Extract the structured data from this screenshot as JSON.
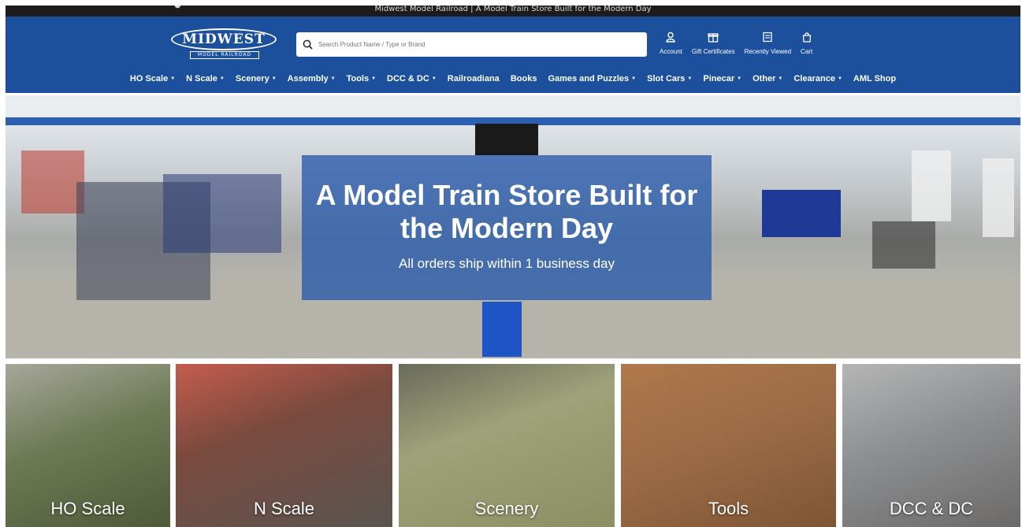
{
  "announcement": {
    "text": "Midwest Model Railroad | A Model Train Store Built for the Modern Day"
  },
  "logo": {
    "main": "MIDWEST",
    "sub": "MODEL RAILROAD"
  },
  "search": {
    "placeholder": "Search Product Name / Type or Brand"
  },
  "header_actions": [
    {
      "label": "Account",
      "icon": "user-icon"
    },
    {
      "label": "Gift Certificates",
      "icon": "gift-icon"
    },
    {
      "label": "Recently Viewed",
      "icon": "recently-viewed-icon"
    },
    {
      "label": "Cart",
      "icon": "cart-icon"
    }
  ],
  "nav": [
    {
      "label": "HO Scale",
      "dropdown": true
    },
    {
      "label": "N Scale",
      "dropdown": true
    },
    {
      "label": "Scenery",
      "dropdown": true
    },
    {
      "label": "Assembly",
      "dropdown": true
    },
    {
      "label": "Tools",
      "dropdown": true
    },
    {
      "label": "DCC & DC",
      "dropdown": true
    },
    {
      "label": "Railroadiana",
      "dropdown": false
    },
    {
      "label": "Books",
      "dropdown": false
    },
    {
      "label": "Games and Puzzles",
      "dropdown": true
    },
    {
      "label": "Slot Cars",
      "dropdown": true
    },
    {
      "label": "Pinecar",
      "dropdown": true
    },
    {
      "label": "Other",
      "dropdown": true
    },
    {
      "label": "Clearance",
      "dropdown": true
    },
    {
      "label": "AML Shop",
      "dropdown": false
    }
  ],
  "hero": {
    "title": "A Model Train Store Built for the Modern Day",
    "subtitle": "All orders ship within 1 business day"
  },
  "categories": [
    {
      "label": "HO Scale",
      "color": "#6d7a55"
    },
    {
      "label": "N Scale",
      "color": "#7a4a3e"
    },
    {
      "label": "Scenery",
      "color": "#8c8f62"
    },
    {
      "label": "Tools",
      "color": "#9b6a45"
    },
    {
      "label": "DCC & DC",
      "color": "#8d8f92"
    }
  ],
  "colors": {
    "header_bg": "#1c4f9c",
    "hero_overlay": "#285aaa"
  }
}
